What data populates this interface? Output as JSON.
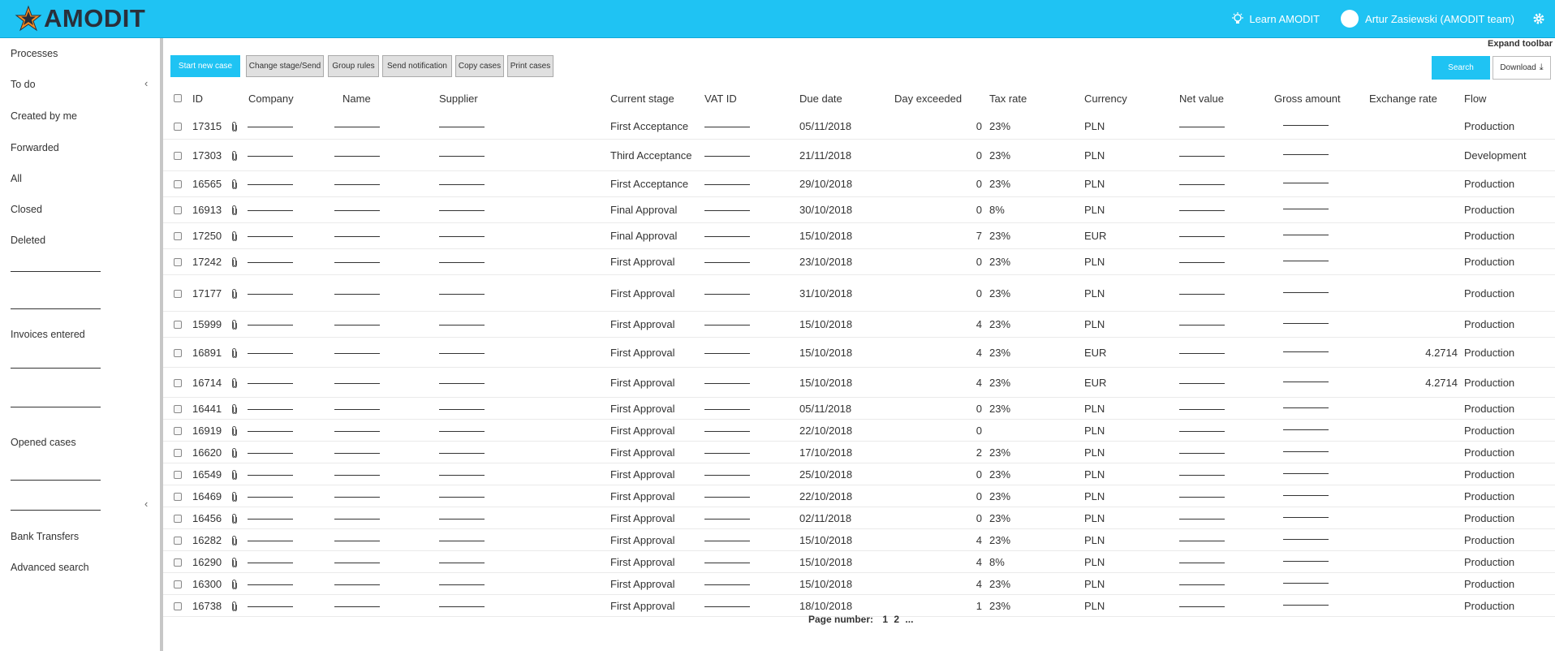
{
  "header": {
    "logo_text": "AMODIT",
    "learn_label": "Learn AMODIT",
    "user_name": "Artur Zasiewski (AMODIT team)",
    "accent": "#1fc3f3"
  },
  "sidebar": {
    "items": [
      {
        "label": "Processes"
      },
      {
        "label": "To do"
      },
      {
        "label": "Created by me"
      },
      {
        "label": "Forwarded"
      },
      {
        "label": "All"
      },
      {
        "label": "Closed"
      },
      {
        "label": "Deleted"
      },
      {
        "label": "Invoices entered"
      },
      {
        "label": "Opened cases"
      },
      {
        "label": "Bank Transfers"
      },
      {
        "label": "Advanced search"
      }
    ]
  },
  "toolbar": {
    "expand_label": "Expand toolbar",
    "start_new_case": "Start new case",
    "change_stage": "Change stage/Send",
    "group_rules": "Group rules",
    "send_notification": "Send notification",
    "copy_cases": "Copy cases",
    "print_cases": "Print cases",
    "search": "Search",
    "download": "Download"
  },
  "table": {
    "columns": [
      "ID",
      "Company",
      "Name",
      "Supplier",
      "Current stage",
      "VAT ID",
      "Due date",
      "Day exceeded",
      "Tax rate",
      "Currency",
      "Net value",
      "Gross amount",
      "Exchange rate",
      "Flow"
    ],
    "rows": [
      {
        "id": "17315",
        "stage": "First Acceptance",
        "due": "05/11/2018",
        "days": "0",
        "tax": "23%",
        "currency": "PLN",
        "rate": "",
        "flow": "Production"
      },
      {
        "id": "17303",
        "stage": "Third Acceptance",
        "due": "21/11/2018",
        "days": "0",
        "tax": "23%",
        "currency": "PLN",
        "rate": "",
        "flow": "Development"
      },
      {
        "id": "16565",
        "stage": "First Acceptance",
        "due": "29/10/2018",
        "days": "0",
        "tax": "23%",
        "currency": "PLN",
        "rate": "",
        "flow": "Production"
      },
      {
        "id": "16913",
        "stage": "Final Approval",
        "due": "30/10/2018",
        "days": "0",
        "tax": "8%",
        "currency": "PLN",
        "rate": "",
        "flow": "Production"
      },
      {
        "id": "17250",
        "stage": "Final Approval",
        "due": "15/10/2018",
        "days": "7",
        "tax": "23%",
        "currency": "EUR",
        "rate": "",
        "flow": "Production"
      },
      {
        "id": "17242",
        "stage": "First Approval",
        "due": "23/10/2018",
        "days": "0",
        "tax": "23%",
        "currency": "PLN",
        "rate": "",
        "flow": "Production"
      },
      {
        "id": "17177",
        "stage": "First Approval",
        "due": "31/10/2018",
        "days": "0",
        "tax": "23%",
        "currency": "PLN",
        "rate": "",
        "flow": "Production"
      },
      {
        "id": "15999",
        "stage": "First Approval",
        "due": "15/10/2018",
        "days": "4",
        "tax": "23%",
        "currency": "PLN",
        "rate": "",
        "flow": "Production"
      },
      {
        "id": "16891",
        "stage": "First Approval",
        "due": "15/10/2018",
        "days": "4",
        "tax": "23%",
        "currency": "EUR",
        "rate": "4.2714",
        "flow": "Production"
      },
      {
        "id": "16714",
        "stage": "First Approval",
        "due": "15/10/2018",
        "days": "4",
        "tax": "23%",
        "currency": "EUR",
        "rate": "4.2714",
        "flow": "Production"
      },
      {
        "id": "16441",
        "stage": "First Approval",
        "due": "05/11/2018",
        "days": "0",
        "tax": "23%",
        "currency": "PLN",
        "rate": "",
        "flow": "Production"
      },
      {
        "id": "16919",
        "stage": "First Approval",
        "due": "22/10/2018",
        "days": "0",
        "tax": "",
        "currency": "PLN",
        "rate": "",
        "flow": "Production"
      },
      {
        "id": "16620",
        "stage": "First Approval",
        "due": "17/10/2018",
        "days": "2",
        "tax": "23%",
        "currency": "PLN",
        "rate": "",
        "flow": "Production"
      },
      {
        "id": "16549",
        "stage": "First Approval",
        "due": "25/10/2018",
        "days": "0",
        "tax": "23%",
        "currency": "PLN",
        "rate": "",
        "flow": "Production"
      },
      {
        "id": "16469",
        "stage": "First Approval",
        "due": "22/10/2018",
        "days": "0",
        "tax": "23%",
        "currency": "PLN",
        "rate": "",
        "flow": "Production"
      },
      {
        "id": "16456",
        "stage": "First Approval",
        "due": "02/11/2018",
        "days": "0",
        "tax": "23%",
        "currency": "PLN",
        "rate": "",
        "flow": "Production"
      },
      {
        "id": "16282",
        "stage": "First Approval",
        "due": "15/10/2018",
        "days": "4",
        "tax": "23%",
        "currency": "PLN",
        "rate": "",
        "flow": "Production"
      },
      {
        "id": "16290",
        "stage": "First Approval",
        "due": "15/10/2018",
        "days": "4",
        "tax": "8%",
        "currency": "PLN",
        "rate": "",
        "flow": "Production"
      },
      {
        "id": "16300",
        "stage": "First Approval",
        "due": "15/10/2018",
        "days": "4",
        "tax": "23%",
        "currency": "PLN",
        "rate": "",
        "flow": "Production"
      },
      {
        "id": "16738",
        "stage": "First Approval",
        "due": "18/10/2018",
        "days": "1",
        "tax": "23%",
        "currency": "PLN",
        "rate": "",
        "flow": "Production"
      }
    ]
  },
  "pager": {
    "label": "Page number:",
    "pages": [
      "1",
      "2",
      "..."
    ]
  }
}
